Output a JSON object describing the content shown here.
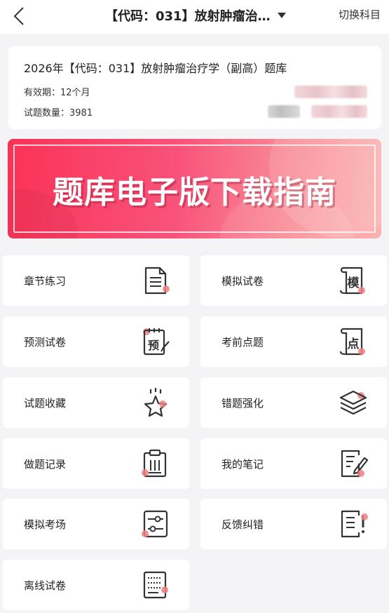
{
  "header": {
    "title": "【代码：031】放射肿瘤治…",
    "switch_label": "切换科目"
  },
  "info": {
    "title": "2026年【代码：031】放射肿瘤治疗学（副高）题库",
    "validity": "有效期：12个月",
    "question_count": "试题数量：3981"
  },
  "banner": {
    "text": "题库电子版下载指南"
  },
  "menu": [
    {
      "label": "章节练习",
      "icon": "document-lines-icon"
    },
    {
      "label": "模拟试卷",
      "icon": "scroll-mo-icon"
    },
    {
      "label": "预测试卷",
      "icon": "notepad-yu-icon"
    },
    {
      "label": "考前点题",
      "icon": "scroll-dian-icon"
    },
    {
      "label": "试题收藏",
      "icon": "star-icon"
    },
    {
      "label": "错题强化",
      "icon": "layers-icon"
    },
    {
      "label": "做题记录",
      "icon": "clipboard-icon"
    },
    {
      "label": "我的笔记",
      "icon": "note-pencil-icon"
    },
    {
      "label": "模拟考场",
      "icon": "sliders-icon"
    },
    {
      "label": "反馈纠错",
      "icon": "feedback-icon"
    },
    {
      "label": "离线试卷",
      "icon": "offline-paper-icon"
    }
  ],
  "colors": {
    "accent": "#f9527a",
    "dot": "#f08080",
    "icon_stroke": "#333333"
  }
}
